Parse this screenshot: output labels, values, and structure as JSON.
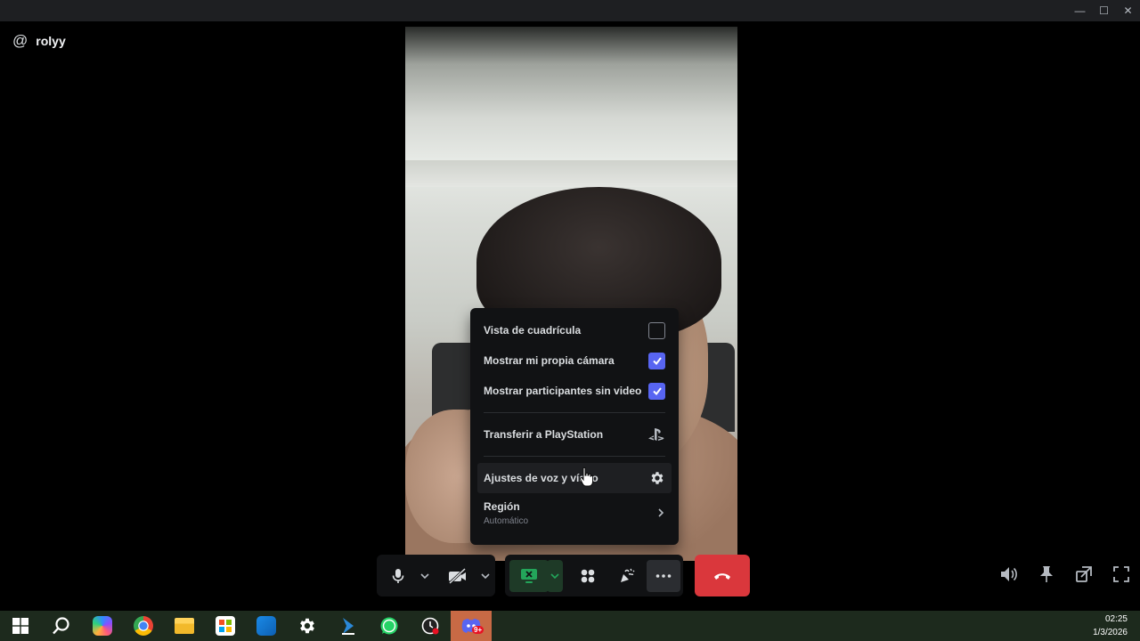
{
  "window": {
    "minimize": "—",
    "maximize": "☐",
    "close": "✕"
  },
  "call": {
    "user_prefix": "@",
    "username": "rolyy"
  },
  "menu": {
    "grid_view": "Vista de cuadrícula",
    "show_own_camera": "Mostrar mi propia cámara",
    "show_no_video": "Mostrar participantes sin video",
    "transfer_ps": "Transferir a PlayStation",
    "voice_video_settings": "Ajustes de voz y vídeo",
    "region": "Región",
    "region_value": "Automático",
    "grid_view_checked": false,
    "show_own_camera_checked": true,
    "show_no_video_checked": true
  },
  "colors": {
    "accent": "#5865f2",
    "hangup": "#da373c",
    "screen_share": "#23a55a"
  },
  "taskbar": {
    "icons": [
      "windows-start-icon",
      "search-icon",
      "copilot-icon",
      "chrome-icon",
      "file-explorer-icon",
      "microsoft-store-icon",
      "outlook-icon",
      "settings-icon",
      "power-automate-icon",
      "whatsapp-icon",
      "clock-app-icon",
      "discord-icon"
    ],
    "time": "02:25",
    "date": "1/3/2026",
    "discord_badge": "9+"
  }
}
